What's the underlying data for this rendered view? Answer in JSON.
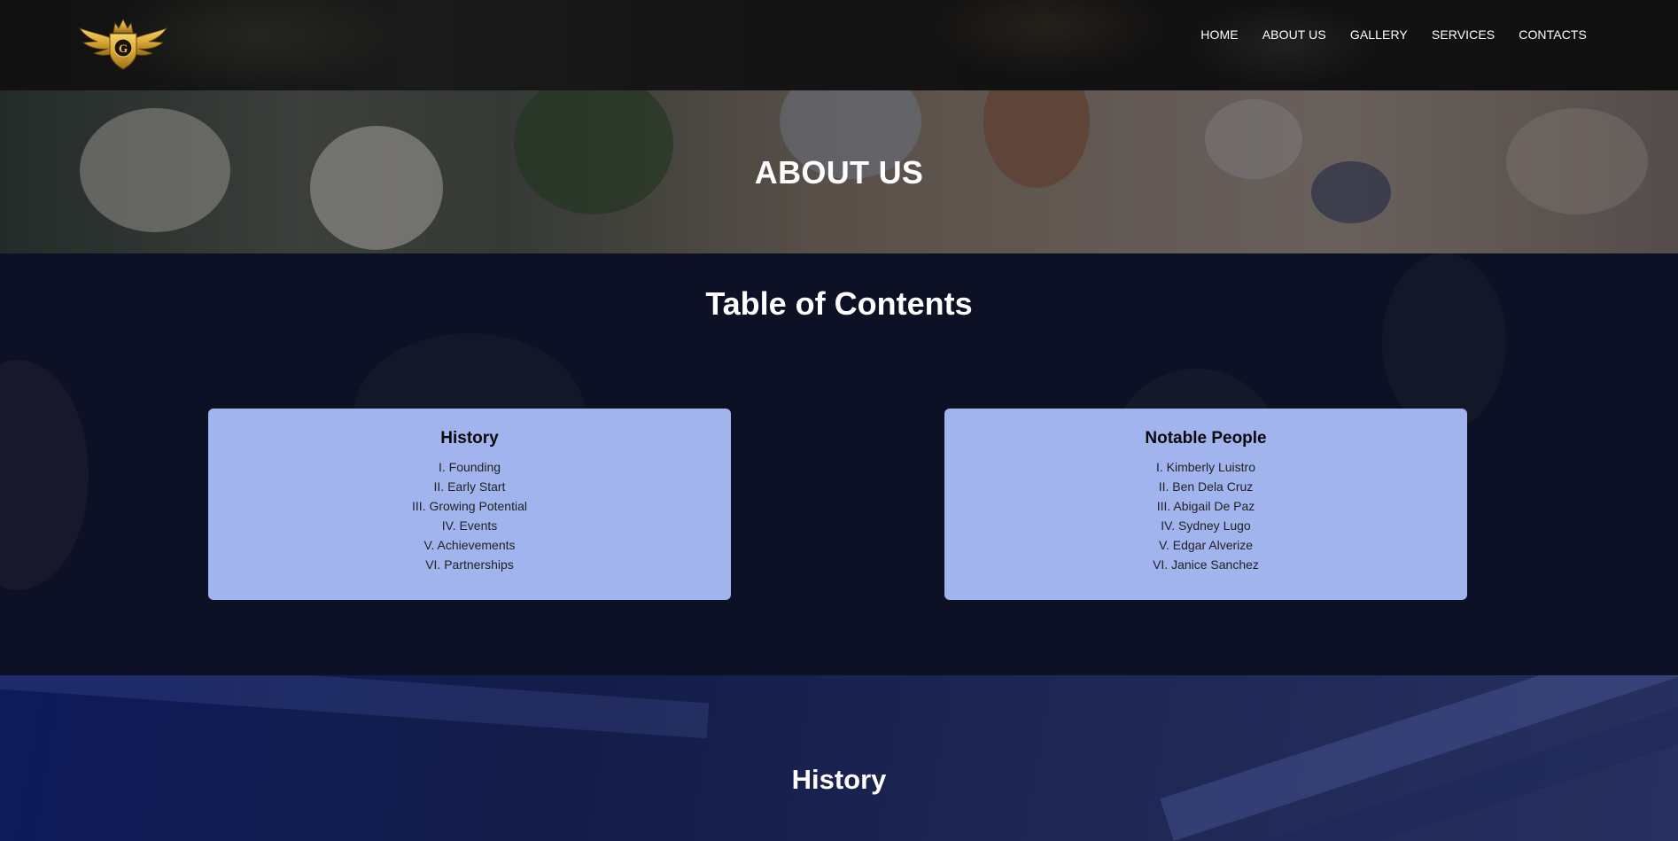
{
  "header": {
    "logo_icon": "winged-crown-shield-logo",
    "nav": [
      "HOME",
      "ABOUT US",
      "GALLERY",
      "SERVICES",
      "CONTACTS"
    ]
  },
  "hero": {
    "title": "ABOUT US"
  },
  "toc": {
    "title": "Table of Contents",
    "cards": [
      {
        "heading": "History",
        "items": [
          "I. Founding",
          "II. Early Start",
          "III. Growing Potential",
          "IV. Events",
          "V. Achievements",
          "VI. Partnerships"
        ]
      },
      {
        "heading": "Notable People",
        "items": [
          "I. Kimberly Luistro",
          "II. Ben Dela Cruz",
          "III. Abigail De Paz",
          "IV. Sydney Lugo",
          "V. Edgar Alverize",
          "VI. Janice Sanchez"
        ]
      }
    ]
  },
  "history": {
    "title": "History"
  },
  "colors": {
    "card_bg": "#a2b4ee",
    "logo_gold": "#d9a935",
    "page_bg": "#0d1126"
  }
}
